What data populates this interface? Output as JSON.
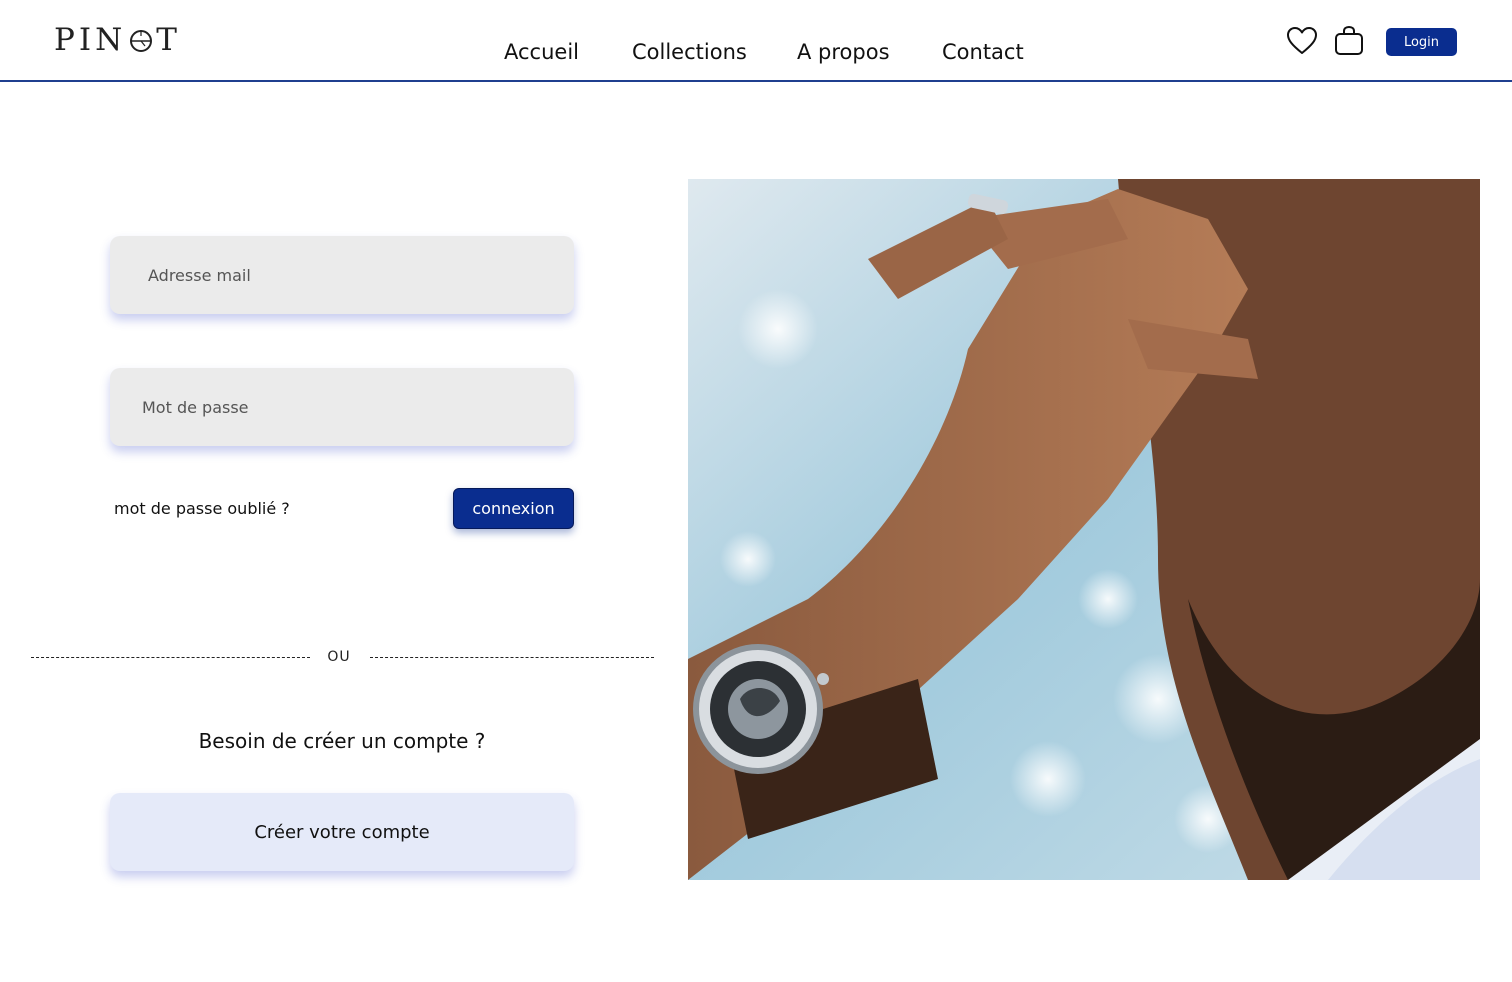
{
  "brand": {
    "logo_text": "PINOT",
    "accent_color": "#0a2d8f"
  },
  "nav": {
    "items": [
      {
        "label": "Accueil"
      },
      {
        "label": "Collections"
      },
      {
        "label": "A propos"
      },
      {
        "label": "Contact"
      }
    ]
  },
  "header_actions": {
    "favorites_icon": "heart-icon",
    "cart_icon": "shopping-bag-icon",
    "login_label": "Login"
  },
  "login_form": {
    "email_placeholder": "Adresse mail",
    "password_placeholder": "Mot de passe",
    "forgot_label": "mot de passe oublié ?",
    "submit_label": "connexion"
  },
  "divider_label": "OU",
  "signup": {
    "prompt": "Besoin de créer un compte ?",
    "button_label": "Créer votre compte"
  },
  "hero_image": {
    "subject": "photo"
  }
}
